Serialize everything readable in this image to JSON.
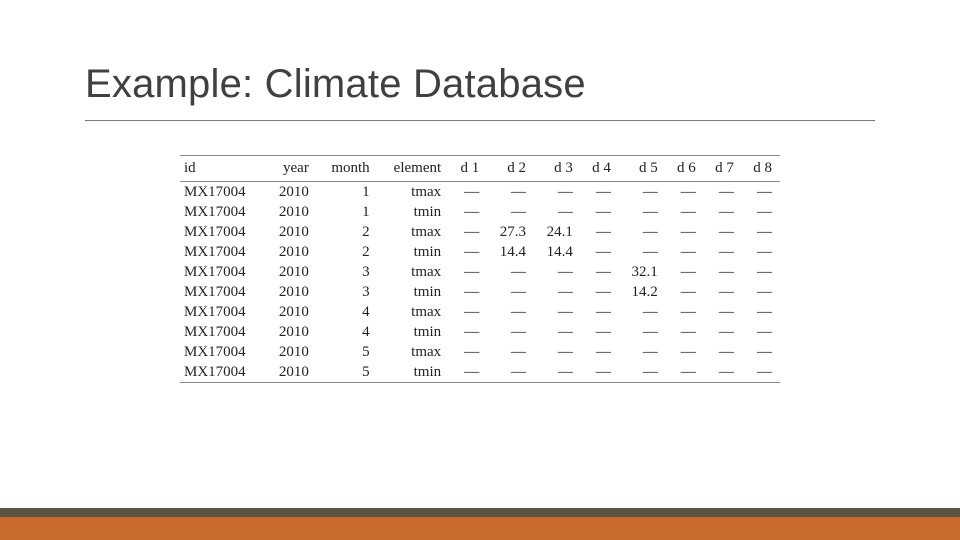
{
  "title": "Example: Climate Database",
  "columns": [
    "id",
    "year",
    "month",
    "element",
    "d 1",
    "d 2",
    "d 3",
    "d 4",
    "d 5",
    "d 6",
    "d 7",
    "d 8"
  ],
  "rows": [
    {
      "id": "MX17004",
      "year": "2010",
      "month": "1",
      "element": "tmax",
      "d1": "—",
      "d2": "—",
      "d3": "—",
      "d4": "—",
      "d5": "—",
      "d6": "—",
      "d7": "—",
      "d8": "—"
    },
    {
      "id": "MX17004",
      "year": "2010",
      "month": "1",
      "element": "tmin",
      "d1": "—",
      "d2": "—",
      "d3": "—",
      "d4": "—",
      "d5": "—",
      "d6": "—",
      "d7": "—",
      "d8": "—"
    },
    {
      "id": "MX17004",
      "year": "2010",
      "month": "2",
      "element": "tmax",
      "d1": "—",
      "d2": "27.3",
      "d3": "24.1",
      "d4": "—",
      "d5": "—",
      "d6": "—",
      "d7": "—",
      "d8": "—"
    },
    {
      "id": "MX17004",
      "year": "2010",
      "month": "2",
      "element": "tmin",
      "d1": "—",
      "d2": "14.4",
      "d3": "14.4",
      "d4": "—",
      "d5": "—",
      "d6": "—",
      "d7": "—",
      "d8": "—"
    },
    {
      "id": "MX17004",
      "year": "2010",
      "month": "3",
      "element": "tmax",
      "d1": "—",
      "d2": "—",
      "d3": "—",
      "d4": "—",
      "d5": "32.1",
      "d6": "—",
      "d7": "—",
      "d8": "—"
    },
    {
      "id": "MX17004",
      "year": "2010",
      "month": "3",
      "element": "tmin",
      "d1": "—",
      "d2": "—",
      "d3": "—",
      "d4": "—",
      "d5": "14.2",
      "d6": "—",
      "d7": "—",
      "d8": "—"
    },
    {
      "id": "MX17004",
      "year": "2010",
      "month": "4",
      "element": "tmax",
      "d1": "—",
      "d2": "—",
      "d3": "—",
      "d4": "—",
      "d5": "—",
      "d6": "—",
      "d7": "—",
      "d8": "—"
    },
    {
      "id": "MX17004",
      "year": "2010",
      "month": "4",
      "element": "tmin",
      "d1": "—",
      "d2": "—",
      "d3": "—",
      "d4": "—",
      "d5": "—",
      "d6": "—",
      "d7": "—",
      "d8": "—"
    },
    {
      "id": "MX17004",
      "year": "2010",
      "month": "5",
      "element": "tmax",
      "d1": "—",
      "d2": "—",
      "d3": "—",
      "d4": "—",
      "d5": "—",
      "d6": "—",
      "d7": "—",
      "d8": "—"
    },
    {
      "id": "MX17004",
      "year": "2010",
      "month": "5",
      "element": "tmin",
      "d1": "—",
      "d2": "—",
      "d3": "—",
      "d4": "—",
      "d5": "—",
      "d6": "—",
      "d7": "—",
      "d8": "—"
    }
  ],
  "chart_data": {
    "type": "table",
    "title": "Example: Climate Database",
    "columns": [
      "id",
      "year",
      "month",
      "element",
      "d1",
      "d2",
      "d3",
      "d4",
      "d5",
      "d6",
      "d7",
      "d8"
    ],
    "values": [
      [
        "MX17004",
        2010,
        1,
        "tmax",
        null,
        null,
        null,
        null,
        null,
        null,
        null,
        null
      ],
      [
        "MX17004",
        2010,
        1,
        "tmin",
        null,
        null,
        null,
        null,
        null,
        null,
        null,
        null
      ],
      [
        "MX17004",
        2010,
        2,
        "tmax",
        null,
        27.3,
        24.1,
        null,
        null,
        null,
        null,
        null
      ],
      [
        "MX17004",
        2010,
        2,
        "tmin",
        null,
        14.4,
        14.4,
        null,
        null,
        null,
        null,
        null
      ],
      [
        "MX17004",
        2010,
        3,
        "tmax",
        null,
        null,
        null,
        null,
        32.1,
        null,
        null,
        null
      ],
      [
        "MX17004",
        2010,
        3,
        "tmin",
        null,
        null,
        null,
        null,
        14.2,
        null,
        null,
        null
      ],
      [
        "MX17004",
        2010,
        4,
        "tmax",
        null,
        null,
        null,
        null,
        null,
        null,
        null,
        null
      ],
      [
        "MX17004",
        2010,
        4,
        "tmin",
        null,
        null,
        null,
        null,
        null,
        null,
        null,
        null
      ],
      [
        "MX17004",
        2010,
        5,
        "tmax",
        null,
        null,
        null,
        null,
        null,
        null,
        null,
        null
      ],
      [
        "MX17004",
        2010,
        5,
        "tmin",
        null,
        null,
        null,
        null,
        null,
        null,
        null,
        null
      ]
    ]
  }
}
